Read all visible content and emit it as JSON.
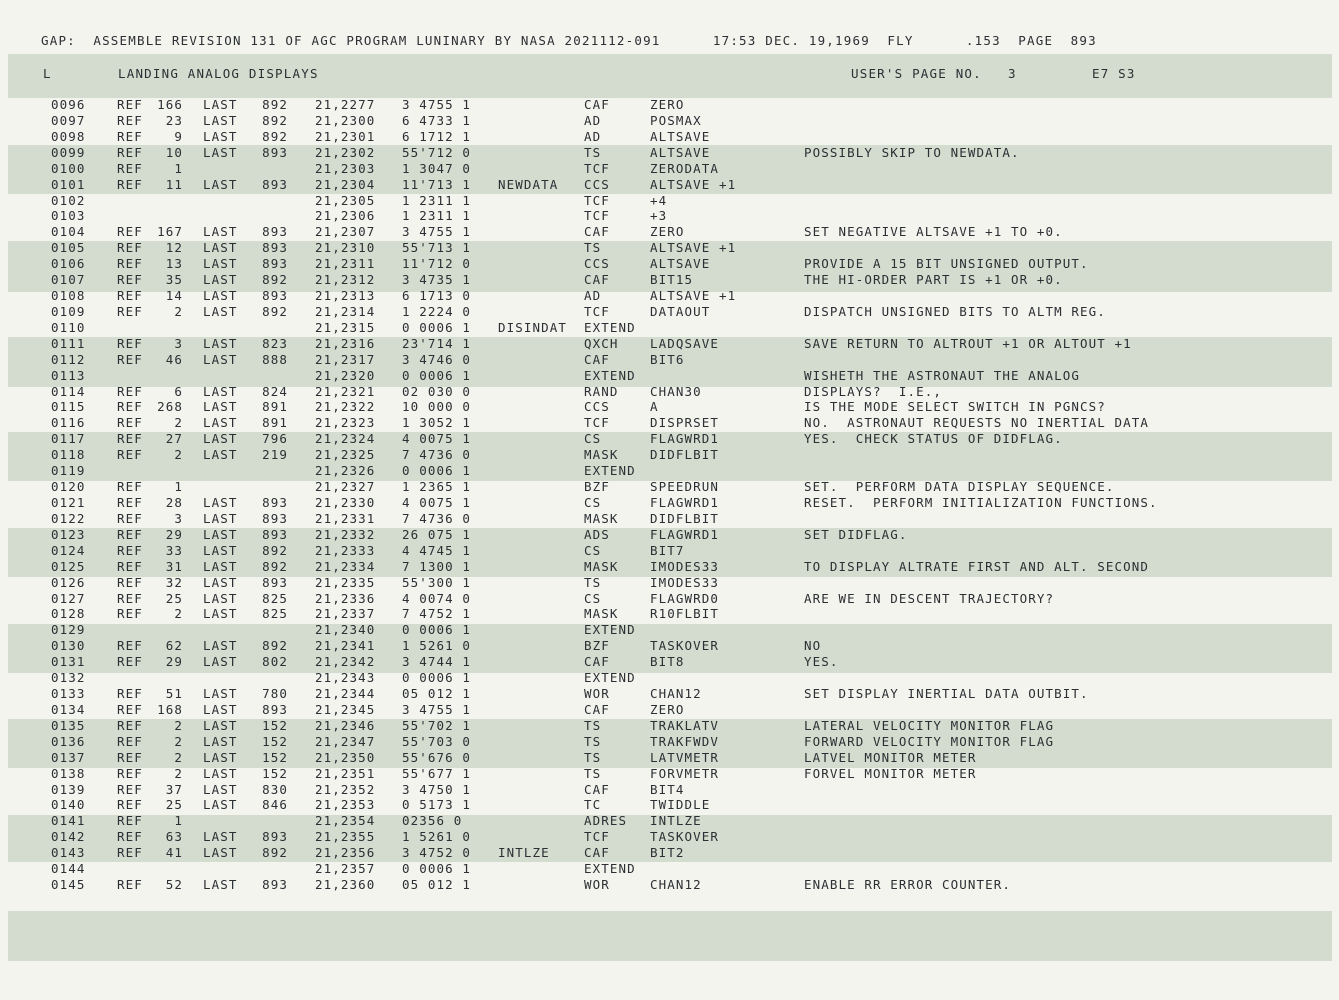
{
  "header": {
    "text": "GAP:  ASSEMBLE REVISION 131 OF AGC PROGRAM LUNINARY BY NASA 2021112-091      17:53 DEC. 19,1969  FLY      .153  PAGE  893"
  },
  "subheader": {
    "type_letter": "L",
    "section_title": "LANDING ANALOG DISPLAYS",
    "users_page": "USER'S PAGE NO.   3",
    "id": "E7 S3"
  },
  "rows": [
    {
      "line": "0096",
      "ref": "REF",
      "refno": "166",
      "last": "LAST",
      "lastno": "892",
      "addr": "21,2277",
      "oct": "3 4755 1",
      "label": "",
      "op": "CAF",
      "operand": "ZERO",
      "comment": ""
    },
    {
      "line": "0097",
      "ref": "REF",
      "refno": "23",
      "last": "LAST",
      "lastno": "892",
      "addr": "21,2300",
      "oct": "6 4733 1",
      "label": "",
      "op": "AD",
      "operand": "POSMAX",
      "comment": ""
    },
    {
      "line": "0098",
      "ref": "REF",
      "refno": "9",
      "last": "LAST",
      "lastno": "892",
      "addr": "21,2301",
      "oct": "6 1712 1",
      "label": "",
      "op": "AD",
      "operand": "ALTSAVE",
      "comment": ""
    },
    {
      "line": "0099",
      "ref": "REF",
      "refno": "10",
      "last": "LAST",
      "lastno": "893",
      "addr": "21,2302",
      "oct": "55'712 0",
      "label": "",
      "op": "TS",
      "operand": "ALTSAVE",
      "comment": "POSSIBLY SKIP TO NEWDATA."
    },
    {
      "line": "0100",
      "ref": "REF",
      "refno": "1",
      "last": "",
      "lastno": "",
      "addr": "21,2303",
      "oct": "1 3047 0",
      "label": "",
      "op": "TCF",
      "operand": "ZERODATA",
      "comment": ""
    },
    {
      "line": "0101",
      "ref": "REF",
      "refno": "11",
      "last": "LAST",
      "lastno": "893",
      "addr": "21,2304",
      "oct": "11'713 1",
      "label": "NEWDATA",
      "op": "CCS",
      "operand": "ALTSAVE +1",
      "comment": ""
    },
    {
      "line": "0102",
      "ref": "",
      "refno": "",
      "last": "",
      "lastno": "",
      "addr": "21,2305",
      "oct": "1 2311 1",
      "label": "",
      "op": "TCF",
      "operand": "+4",
      "comment": ""
    },
    {
      "line": "0103",
      "ref": "",
      "refno": "",
      "last": "",
      "lastno": "",
      "addr": "21,2306",
      "oct": "1 2311 1",
      "label": "",
      "op": "TCF",
      "operand": "+3",
      "comment": ""
    },
    {
      "line": "0104",
      "ref": "REF",
      "refno": "167",
      "last": "LAST",
      "lastno": "893",
      "addr": "21,2307",
      "oct": "3 4755 1",
      "label": "",
      "op": "CAF",
      "operand": "ZERO",
      "comment": "SET NEGATIVE ALTSAVE +1 TO +0."
    },
    {
      "line": "0105",
      "ref": "REF",
      "refno": "12",
      "last": "LAST",
      "lastno": "893",
      "addr": "21,2310",
      "oct": "55'713 1",
      "label": "",
      "op": "TS",
      "operand": "ALTSAVE +1",
      "comment": ""
    },
    {
      "line": "0106",
      "ref": "REF",
      "refno": "13",
      "last": "LAST",
      "lastno": "893",
      "addr": "21,2311",
      "oct": "11'712 0",
      "label": "",
      "op": "CCS",
      "operand": "ALTSAVE",
      "comment": "PROVIDE A 15 BIT UNSIGNED OUTPUT."
    },
    {
      "line": "0107",
      "ref": "REF",
      "refno": "35",
      "last": "LAST",
      "lastno": "892",
      "addr": "21,2312",
      "oct": "3 4735 1",
      "label": "",
      "op": "CAF",
      "operand": "BIT15",
      "comment": "THE HI-ORDER PART IS +1 OR +0."
    },
    {
      "line": "0108",
      "ref": "REF",
      "refno": "14",
      "last": "LAST",
      "lastno": "893",
      "addr": "21,2313",
      "oct": "6 1713 0",
      "label": "",
      "op": "AD",
      "operand": "ALTSAVE +1",
      "comment": ""
    },
    {
      "line": "0109",
      "ref": "REF",
      "refno": "2",
      "last": "LAST",
      "lastno": "892",
      "addr": "21,2314",
      "oct": "1 2224 0",
      "label": "",
      "op": "TCF",
      "operand": "DATAOUT",
      "comment": "DISPATCH UNSIGNED BITS TO ALTM REG."
    },
    {
      "line": "0110",
      "ref": "",
      "refno": "",
      "last": "",
      "lastno": "",
      "addr": "21,2315",
      "oct": "0 0006 1",
      "label": "DISINDAT",
      "op": "EXTEND",
      "operand": "",
      "comment": ""
    },
    {
      "line": "0111",
      "ref": "REF",
      "refno": "3",
      "last": "LAST",
      "lastno": "823",
      "addr": "21,2316",
      "oct": "23'714 1",
      "label": "",
      "op": "QXCH",
      "operand": "LADQSAVE",
      "comment": "SAVE RETURN TO ALTROUT +1 OR ALTOUT +1"
    },
    {
      "line": "0112",
      "ref": "REF",
      "refno": "46",
      "last": "LAST",
      "lastno": "888",
      "addr": "21,2317",
      "oct": "3 4746 0",
      "label": "",
      "op": "CAF",
      "operand": "BIT6",
      "comment": ""
    },
    {
      "line": "0113",
      "ref": "",
      "refno": "",
      "last": "",
      "lastno": "",
      "addr": "21,2320",
      "oct": "0 0006 1",
      "label": "",
      "op": "EXTEND",
      "operand": "",
      "comment": "WISHETH THE ASTRONAUT THE ANALOG"
    },
    {
      "line": "0114",
      "ref": "REF",
      "refno": "6",
      "last": "LAST",
      "lastno": "824",
      "addr": "21,2321",
      "oct": "02 030 0",
      "label": "",
      "op": "RAND",
      "operand": "CHAN30",
      "comment": "DISPLAYS?  I.E.,"
    },
    {
      "line": "0115",
      "ref": "REF",
      "refno": "268",
      "last": "LAST",
      "lastno": "891",
      "addr": "21,2322",
      "oct": "10 000 0",
      "label": "",
      "op": "CCS",
      "operand": "A",
      "comment": "IS THE MODE SELECT SWITCH IN PGNCS?"
    },
    {
      "line": "0116",
      "ref": "REF",
      "refno": "2",
      "last": "LAST",
      "lastno": "891",
      "addr": "21,2323",
      "oct": "1 3052 1",
      "label": "",
      "op": "TCF",
      "operand": "DISPRSET",
      "comment": "NO.  ASTRONAUT REQUESTS NO INERTIAL DATA"
    },
    {
      "line": "0117",
      "ref": "REF",
      "refno": "27",
      "last": "LAST",
      "lastno": "796",
      "addr": "21,2324",
      "oct": "4 0075 1",
      "label": "",
      "op": "CS",
      "operand": "FLAGWRD1",
      "comment": "YES.  CHECK STATUS OF DIDFLAG."
    },
    {
      "line": "0118",
      "ref": "REF",
      "refno": "2",
      "last": "LAST",
      "lastno": "219",
      "addr": "21,2325",
      "oct": "7 4736 0",
      "label": "",
      "op": "MASK",
      "operand": "DIDFLBIT",
      "comment": ""
    },
    {
      "line": "0119",
      "ref": "",
      "refno": "",
      "last": "",
      "lastno": "",
      "addr": "21,2326",
      "oct": "0 0006 1",
      "label": "",
      "op": "EXTEND",
      "operand": "",
      "comment": ""
    },
    {
      "line": "0120",
      "ref": "REF",
      "refno": "1",
      "last": "",
      "lastno": "",
      "addr": "21,2327",
      "oct": "1 2365 1",
      "label": "",
      "op": "BZF",
      "operand": "SPEEDRUN",
      "comment": "SET.  PERFORM DATA DISPLAY SEQUENCE."
    },
    {
      "line": "0121",
      "ref": "REF",
      "refno": "28",
      "last": "LAST",
      "lastno": "893",
      "addr": "21,2330",
      "oct": "4 0075 1",
      "label": "",
      "op": "CS",
      "operand": "FLAGWRD1",
      "comment": "RESET.  PERFORM INITIALIZATION FUNCTIONS."
    },
    {
      "line": "0122",
      "ref": "REF",
      "refno": "3",
      "last": "LAST",
      "lastno": "893",
      "addr": "21,2331",
      "oct": "7 4736 0",
      "label": "",
      "op": "MASK",
      "operand": "DIDFLBIT",
      "comment": ""
    },
    {
      "line": "0123",
      "ref": "REF",
      "refno": "29",
      "last": "LAST",
      "lastno": "893",
      "addr": "21,2332",
      "oct": "26 075 1",
      "label": "",
      "op": "ADS",
      "operand": "FLAGWRD1",
      "comment": "SET DIDFLAG."
    },
    {
      "line": "0124",
      "ref": "REF",
      "refno": "33",
      "last": "LAST",
      "lastno": "892",
      "addr": "21,2333",
      "oct": "4 4745 1",
      "label": "",
      "op": "CS",
      "operand": "BIT7",
      "comment": ""
    },
    {
      "line": "0125",
      "ref": "REF",
      "refno": "31",
      "last": "LAST",
      "lastno": "892",
      "addr": "21,2334",
      "oct": "7 1300 1",
      "label": "",
      "op": "MASK",
      "operand": "IMODES33",
      "comment": "TO DISPLAY ALTRATE FIRST AND ALT. SECOND"
    },
    {
      "line": "0126",
      "ref": "REF",
      "refno": "32",
      "last": "LAST",
      "lastno": "893",
      "addr": "21,2335",
      "oct": "55'300 1",
      "label": "",
      "op": "TS",
      "operand": "IMODES33",
      "comment": ""
    },
    {
      "line": "0127",
      "ref": "REF",
      "refno": "25",
      "last": "LAST",
      "lastno": "825",
      "addr": "21,2336",
      "oct": "4 0074 0",
      "label": "",
      "op": "CS",
      "operand": "FLAGWRD0",
      "comment": "ARE WE IN DESCENT TRAJECTORY?"
    },
    {
      "line": "0128",
      "ref": "REF",
      "refno": "2",
      "last": "LAST",
      "lastno": "825",
      "addr": "21,2337",
      "oct": "7 4752 1",
      "label": "",
      "op": "MASK",
      "operand": "R10FLBIT",
      "comment": ""
    },
    {
      "line": "0129",
      "ref": "",
      "refno": "",
      "last": "",
      "lastno": "",
      "addr": "21,2340",
      "oct": "0 0006 1",
      "label": "",
      "op": "EXTEND",
      "operand": "",
      "comment": ""
    },
    {
      "line": "0130",
      "ref": "REF",
      "refno": "62",
      "last": "LAST",
      "lastno": "892",
      "addr": "21,2341",
      "oct": "1 5261 0",
      "label": "",
      "op": "BZF",
      "operand": "TASKOVER",
      "comment": "NO"
    },
    {
      "line": "0131",
      "ref": "REF",
      "refno": "29",
      "last": "LAST",
      "lastno": "802",
      "addr": "21,2342",
      "oct": "3 4744 1",
      "label": "",
      "op": "CAF",
      "operand": "BIT8",
      "comment": "YES."
    },
    {
      "line": "0132",
      "ref": "",
      "refno": "",
      "last": "",
      "lastno": "",
      "addr": "21,2343",
      "oct": "0 0006 1",
      "label": "",
      "op": "EXTEND",
      "operand": "",
      "comment": ""
    },
    {
      "line": "0133",
      "ref": "REF",
      "refno": "51",
      "last": "LAST",
      "lastno": "780",
      "addr": "21,2344",
      "oct": "05 012 1",
      "label": "",
      "op": "WOR",
      "operand": "CHAN12",
      "comment": "SET DISPLAY INERTIAL DATA OUTBIT."
    },
    {
      "line": "0134",
      "ref": "REF",
      "refno": "168",
      "last": "LAST",
      "lastno": "893",
      "addr": "21,2345",
      "oct": "3 4755 1",
      "label": "",
      "op": "CAF",
      "operand": "ZERO",
      "comment": ""
    },
    {
      "line": "0135",
      "ref": "REF",
      "refno": "2",
      "last": "LAST",
      "lastno": "152",
      "addr": "21,2346",
      "oct": "55'702 1",
      "label": "",
      "op": "TS",
      "operand": "TRAKLATV",
      "comment": "LATERAL VELOCITY MONITOR FLAG"
    },
    {
      "line": "0136",
      "ref": "REF",
      "refno": "2",
      "last": "LAST",
      "lastno": "152",
      "addr": "21,2347",
      "oct": "55'703 0",
      "label": "",
      "op": "TS",
      "operand": "TRAKFWDV",
      "comment": "FORWARD VELOCITY MONITOR FLAG"
    },
    {
      "line": "0137",
      "ref": "REF",
      "refno": "2",
      "last": "LAST",
      "lastno": "152",
      "addr": "21,2350",
      "oct": "55'676 0",
      "label": "",
      "op": "TS",
      "operand": "LATVMETR",
      "comment": "LATVEL MONITOR METER"
    },
    {
      "line": "0138",
      "ref": "REF",
      "refno": "2",
      "last": "LAST",
      "lastno": "152",
      "addr": "21,2351",
      "oct": "55'677 1",
      "label": "",
      "op": "TS",
      "operand": "FORVMETR",
      "comment": "FORVEL MONITOR METER"
    },
    {
      "line": "0139",
      "ref": "REF",
      "refno": "37",
      "last": "LAST",
      "lastno": "830",
      "addr": "21,2352",
      "oct": "3 4750 1",
      "label": "",
      "op": "CAF",
      "operand": "BIT4",
      "comment": ""
    },
    {
      "line": "0140",
      "ref": "REF",
      "refno": "25",
      "last": "LAST",
      "lastno": "846",
      "addr": "21,2353",
      "oct": "0 5173 1",
      "label": "",
      "op": "TC",
      "operand": "TWIDDLE",
      "comment": ""
    },
    {
      "line": "0141",
      "ref": "REF",
      "refno": "1",
      "last": "",
      "lastno": "",
      "addr": "21,2354",
      "oct": "02356 0",
      "label": "",
      "op": "ADRES",
      "operand": "INTLZE",
      "comment": ""
    },
    {
      "line": "0142",
      "ref": "REF",
      "refno": "63",
      "last": "LAST",
      "lastno": "893",
      "addr": "21,2355",
      "oct": "1 5261 0",
      "label": "",
      "op": "TCF",
      "operand": "TASKOVER",
      "comment": ""
    },
    {
      "line": "0143",
      "ref": "REF",
      "refno": "41",
      "last": "LAST",
      "lastno": "892",
      "addr": "21,2356",
      "oct": "3 4752 0",
      "label": "INTLZE",
      "op": "CAF",
      "operand": "BIT2",
      "comment": ""
    },
    {
      "line": "0144",
      "ref": "",
      "refno": "",
      "last": "",
      "lastno": "",
      "addr": "21,2357",
      "oct": "0 0006 1",
      "label": "",
      "op": "EXTEND",
      "operand": "",
      "comment": ""
    },
    {
      "line": "0145",
      "ref": "REF",
      "refno": "52",
      "last": "LAST",
      "lastno": "893",
      "addr": "21,2360",
      "oct": "05 012 1",
      "label": "",
      "op": "WOR",
      "operand": "CHAN12",
      "comment": "ENABLE RR ERROR COUNTER."
    }
  ]
}
